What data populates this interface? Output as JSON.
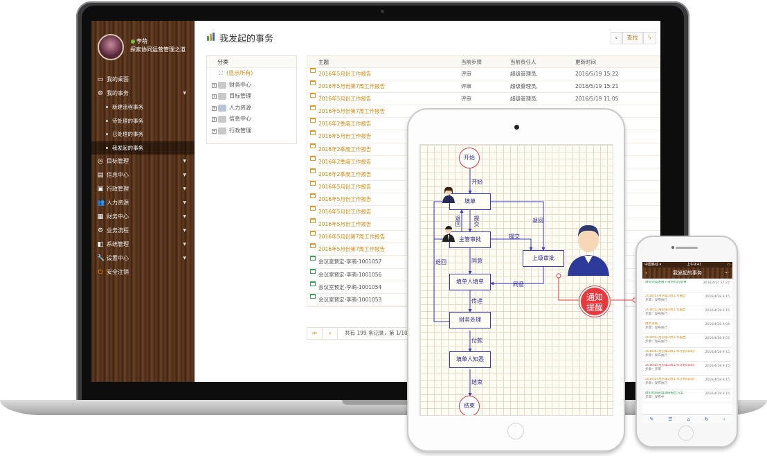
{
  "laptop": {
    "profile": {
      "username": "李萌",
      "motto": "探索协同运营管理之道"
    },
    "menu": [
      {
        "label": "我的桌面",
        "icon": "monitor-icon"
      },
      {
        "label": "我的事务",
        "icon": "gear-icon",
        "expanded": true,
        "children": [
          "新建流程事务",
          "待处理的事务",
          "已处理的事务",
          "我发起的事务"
        ]
      },
      {
        "label": "目标管理",
        "icon": "target-icon"
      },
      {
        "label": "信息中心",
        "icon": "info-icon"
      },
      {
        "label": "行政管理",
        "icon": "admin-icon"
      },
      {
        "label": "人力资源",
        "icon": "users-icon"
      },
      {
        "label": "财务中心",
        "icon": "finance-icon"
      },
      {
        "label": "业务流程",
        "icon": "flow-icon"
      },
      {
        "label": "系统管理",
        "icon": "system-icon"
      },
      {
        "label": "设置中心",
        "icon": "wrench-icon"
      },
      {
        "label": "安全注销",
        "icon": "power-icon"
      }
    ],
    "page_title": "我发起的事务",
    "buttons": {
      "back": "‹",
      "find": "查找",
      "flash": "ϟ"
    },
    "tree": {
      "header": "分类",
      "all": "(显示所有)",
      "nodes": [
        "财务中心",
        "目标管理",
        "人力资源",
        "信息中心",
        "行政管理"
      ]
    },
    "table": {
      "columns": [
        "主题",
        "当前步骤",
        "当前责任人",
        "更新时间"
      ],
      "rows": [
        {
          "subject": "2016年5月份工作报告",
          "step": "评审",
          "owner": "超级管理员,",
          "time": "2016/5/19 15:22",
          "kind": "report"
        },
        {
          "subject": "2016年5月份第7周工作报告",
          "step": "评审",
          "owner": "超级管理员,",
          "time": "2016/5/19 15:21",
          "kind": "report"
        },
        {
          "subject": "2016年5月份工作报告",
          "step": "评审",
          "owner": "超级管理员,",
          "time": "2016/5/19 11:05",
          "kind": "report"
        },
        {
          "subject": "2016年5月份第7周工作报告",
          "step": "",
          "owner": "",
          "time": "",
          "kind": "report"
        },
        {
          "subject": "2016年2季度工作报告",
          "step": "",
          "owner": "",
          "time": "",
          "kind": "report"
        },
        {
          "subject": "2016年5月份工作报告",
          "step": "",
          "owner": "",
          "time": "",
          "kind": "report"
        },
        {
          "subject": "2016年2季度工作报告",
          "step": "",
          "owner": "",
          "time": "",
          "kind": "report"
        },
        {
          "subject": "2016年2季度工作报告",
          "step": "",
          "owner": "",
          "time": "",
          "kind": "report"
        },
        {
          "subject": "2016年2季度工作报告",
          "step": "",
          "owner": "",
          "time": "",
          "kind": "report"
        },
        {
          "subject": "2016年5月份工作报告",
          "step": "",
          "owner": "",
          "time": "",
          "kind": "report"
        },
        {
          "subject": "2016年5月份工作报告",
          "step": "",
          "owner": "",
          "time": "",
          "kind": "report"
        },
        {
          "subject": "2016年5月份工作报告",
          "step": "",
          "owner": "",
          "time": "",
          "kind": "report"
        },
        {
          "subject": "2016年5月份工作报告",
          "step": "",
          "owner": "",
          "time": "",
          "kind": "report"
        },
        {
          "subject": "2016年5月份第7周工作报告",
          "step": "",
          "owner": "",
          "time": "",
          "kind": "report"
        },
        {
          "subject": "2016年5月份第7周工作报告",
          "step": "",
          "owner": "",
          "time": "",
          "kind": "report"
        },
        {
          "subject": "会议室预定-李萌-1001057",
          "step": "",
          "owner": "",
          "time": "",
          "kind": "meeting"
        },
        {
          "subject": "会议室预定-李萌-1001056",
          "step": "",
          "owner": "",
          "time": "",
          "kind": "meeting"
        },
        {
          "subject": "会议室预定-李萌-1001054",
          "step": "",
          "owner": "",
          "time": "",
          "kind": "meeting"
        },
        {
          "subject": "会议室预定-李萌-1001053",
          "step": "",
          "owner": "",
          "time": "",
          "kind": "meeting"
        }
      ]
    },
    "pager": {
      "first": "⏮",
      "prev": "«",
      "summary": "共有 199 条记录，第 1/10 页"
    }
  },
  "tablet": {
    "flow": {
      "start": "开始",
      "end": "结束",
      "fill": "填单",
      "supervisor": "主管审批",
      "superior": "上级审批",
      "handler": "填单人填单",
      "finance": "财务处理",
      "notified": "填单人知悉",
      "labels": {
        "fill": "开始",
        "back1": "退回",
        "submit1": "提交",
        "submit2": "提交",
        "back2": "退回",
        "agree1": "同意",
        "agree2": "同意",
        "back3": "退回",
        "pass": "传递",
        "pay": "付款",
        "done": "结束"
      }
    }
  },
  "notify": {
    "line1": "通知",
    "line2": "提醒"
  },
  "phone": {
    "status_left": "中国移动 ▾",
    "status_mid": "上午9:41",
    "title": "我发起的事务",
    "items": [
      {
        "subject": "目标完成进展下发协作的意事",
        "step": "",
        "date": "2016/4/17 17:27",
        "date2": "",
        "color": "g"
      },
      {
        "subject": "2016年3月份第3周工作报告",
        "step": "步骤：发布执行",
        "date": "2016/4/28 9:15",
        "date2": "",
        "color": "o"
      },
      {
        "subject": "2016年3月份第4周工作报告",
        "step": "步骤：发布执行",
        "date": "2016/4/28 9:15",
        "date2": "",
        "color": "o"
      },
      {
        "subject": "财务审核",
        "step": "步骤：发布执行",
        "date": "2016/4/28 9:04",
        "date2": "",
        "color": "o"
      },
      {
        "subject": "2016年3月份第2周工作报告",
        "step": "步骤：发布执行",
        "date": "2016/4/28 9:03",
        "date2": "",
        "color": "o"
      },
      {
        "subject": "2016年3月份第2周工作计划(李萌)",
        "step": "步骤：发布执行",
        "date": "2016/4/28 9:15",
        "date2": "",
        "color": "o"
      },
      {
        "subject": "2016年5月份第2周工作计划(李萌)",
        "step": "步骤：评审",
        "date": "2016/4/28 9:15",
        "date2": "",
        "color": "r"
      },
      {
        "subject": "2016年3月份第2周工作计划(李萌)",
        "step": "步骤：发布执行",
        "date": "2016/4/28 9:15",
        "date2": "",
        "color": "o"
      },
      {
        "subject": "组织结构管理调研报告方案",
        "step": "步骤：发布中",
        "date": "2016/4/28 9:15",
        "date2": "",
        "color": "g"
      }
    ],
    "bottom": [
      "✎",
      "☰",
      "⌂",
      "↻",
      "‹"
    ]
  }
}
